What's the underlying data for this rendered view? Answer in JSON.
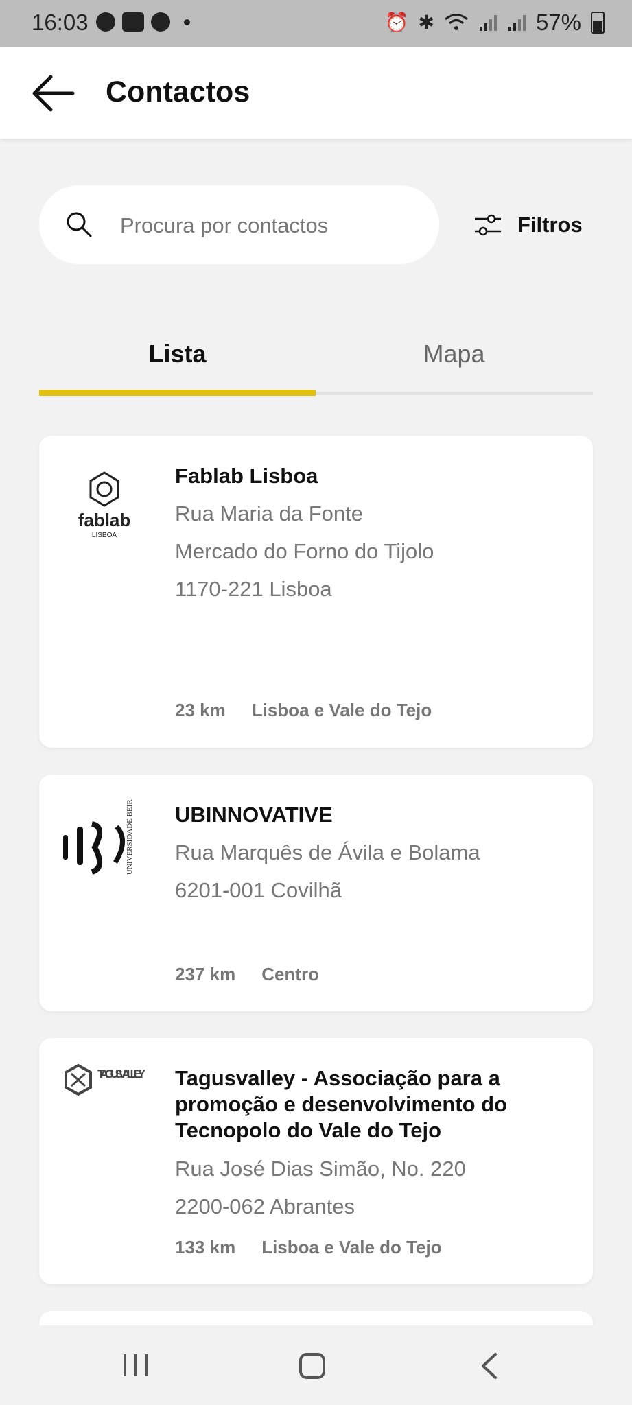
{
  "status_bar": {
    "time": "16:03",
    "left_icons": [
      "notification-icon",
      "teams-icon",
      "notification-icon"
    ],
    "right_icons": [
      "alarm-icon",
      "bluetooth-icon",
      "wifi-icon",
      "signal-icon",
      "signal-icon"
    ],
    "battery": "57%"
  },
  "header": {
    "back_icon": "arrow-left-icon",
    "title": "Contactos"
  },
  "search": {
    "placeholder": "Procura por contactos",
    "value": "",
    "icon": "search-icon"
  },
  "filters": {
    "label": "Filtros",
    "icon": "sliders-icon"
  },
  "tabs": [
    {
      "label": "Lista",
      "selected": true
    },
    {
      "label": "Mapa",
      "selected": false
    }
  ],
  "contacts": [
    {
      "logo": "fablab-logo",
      "logo_text": "fablab",
      "logo_subtext": "LISBOA",
      "name": "Fablab Lisboa",
      "lines": [
        "Rua Maria da Fonte",
        "Mercado do Forno do Tijolo",
        "1170-221 Lisboa"
      ],
      "distance": "23 km",
      "region": "Lisboa e Vale do Tejo"
    },
    {
      "logo": "ubi-logo",
      "logo_text": "UNIVERSIDADE BEIRA INTERIOR",
      "name": "UBINNOVATIVE",
      "lines": [
        "Rua Marquês de Ávila e Bolama",
        "6201-001 Covilhã"
      ],
      "distance": "237 km",
      "region": "Centro"
    },
    {
      "logo": "tagusvalley-logo",
      "logo_text": "TAGUS VALLEY",
      "name": "Tagusvalley - Associação para a promoção e desenvolvimento do Tecnopolo do Vale do Tejo",
      "lines": [
        "Rua José Dias Simão, No. 220",
        "2200-062 Abrantes"
      ],
      "distance": "133 km",
      "region": "Lisboa e Vale do Tejo"
    }
  ],
  "nav_bar": {
    "icons": [
      "recents-icon",
      "home-icon",
      "back-icon"
    ]
  },
  "colors": {
    "accent": "#e3bf0f",
    "background": "#f2f2f2",
    "status_bar": "#bdbdbd",
    "card": "#ffffff",
    "secondary_text": "#777777"
  }
}
